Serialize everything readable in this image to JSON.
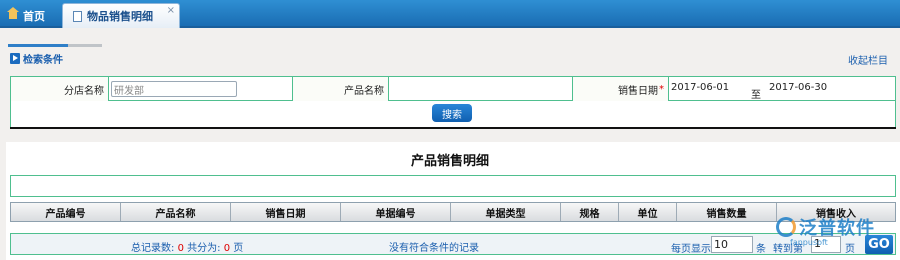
{
  "tabs": [
    {
      "label": "首页",
      "icon": "home-icon",
      "active": false
    },
    {
      "label": "物品销售明细",
      "icon": "document-icon",
      "active": true
    }
  ],
  "tab_close_symbol": "×",
  "search_section": {
    "title": "检索条件",
    "collapse_label": "收起栏目",
    "fields": {
      "store_label": "分店名称",
      "store_value": "研发部",
      "product_label": "产品名称",
      "product_value": "",
      "date_label": "销售日期",
      "required_mark": "*",
      "date_from": "2017-06-01",
      "date_sep": "至",
      "date_to": "2017-06-30"
    },
    "search_button": "搜索"
  },
  "report": {
    "title": "产品销售明细",
    "columns": [
      "产品编号",
      "产品名称",
      "销售日期",
      "单据编号",
      "单据类型",
      "规格",
      "单位",
      "销售数量",
      "销售收入"
    ]
  },
  "pager": {
    "total_label": "总记录数:",
    "total_value": "0",
    "pages_label": "共分为:",
    "pages_value": "0",
    "pages_unit": "页",
    "empty_message": "没有符合条件的记录",
    "page_size_label": "每页显示",
    "page_size": "10",
    "page_size_unit": "条",
    "jump_label": "转到第",
    "jump_value": "1",
    "jump_unit": "页",
    "go_label": "GO"
  },
  "logo": {
    "name": "泛普软件",
    "sub": "fanpusoft"
  },
  "colors": {
    "tabbar": "#1a6db3",
    "accent": "#1b5fae",
    "border": "#4fbf8f",
    "required": "#dd0000"
  }
}
